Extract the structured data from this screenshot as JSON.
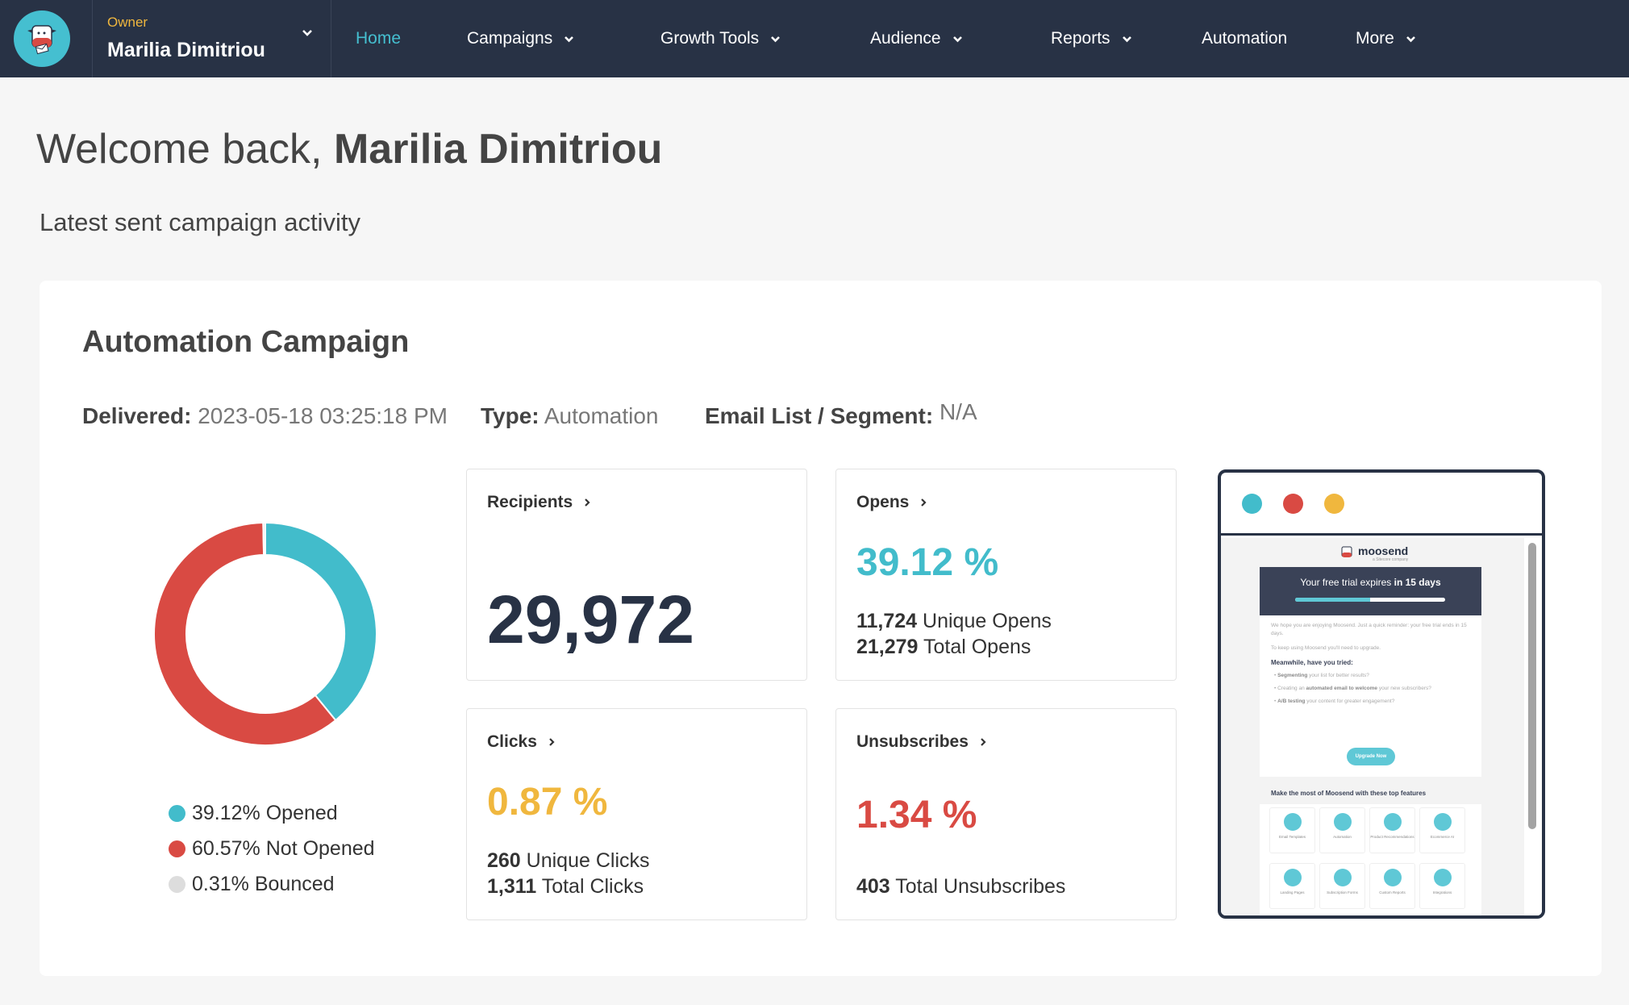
{
  "nav": {
    "logo_icon": "moosend-cow-logo",
    "owner_role": "Owner",
    "owner_name": "Marilia Dimitriou",
    "items": [
      {
        "label": "Home",
        "active": true,
        "dropdown": false
      },
      {
        "label": "Campaigns",
        "active": false,
        "dropdown": true
      },
      {
        "label": "Growth Tools",
        "active": false,
        "dropdown": true
      },
      {
        "label": "Audience",
        "active": false,
        "dropdown": true
      },
      {
        "label": "Reports",
        "active": false,
        "dropdown": true
      },
      {
        "label": "Automation",
        "active": false,
        "dropdown": false
      },
      {
        "label": "More",
        "active": false,
        "dropdown": true
      }
    ]
  },
  "header": {
    "welcome_prefix": "Welcome back, ",
    "welcome_name": "Marilia Dimitriou",
    "subtitle": "Latest sent campaign activity"
  },
  "campaign": {
    "title": "Automation Campaign",
    "delivered_label": "Delivered:",
    "delivered_value": "2023-05-18 03:25:18 PM",
    "type_label": "Type:",
    "type_value": "Automation",
    "list_label": "Email List / Segment:",
    "list_value": "N/A"
  },
  "chart_data": {
    "type": "pie",
    "donut": true,
    "title": "",
    "slices": [
      {
        "label": "Opened",
        "value": 39.12,
        "color": "#42bccb",
        "legend": "39.12% Opened"
      },
      {
        "label": "Not Opened",
        "value": 60.57,
        "color": "#d94a43",
        "legend": "60.57% Not Opened"
      },
      {
        "label": "Bounced",
        "value": 0.31,
        "color": "#dddddd",
        "legend": "0.31% Bounced"
      }
    ],
    "legend_position": "bottom"
  },
  "stats": {
    "recipients": {
      "label": "Recipients",
      "value": "29,972"
    },
    "opens": {
      "label": "Opens",
      "rate": "39.12 %",
      "unique_value": "11,724",
      "unique_label": "Unique Opens",
      "total_value": "21,279",
      "total_label": "Total Opens"
    },
    "clicks": {
      "label": "Clicks",
      "rate": "0.87 %",
      "unique_value": "260",
      "unique_label": "Unique Clicks",
      "total_value": "1,311",
      "total_label": "Total Clicks"
    },
    "unsubscribes": {
      "label": "Unsubscribes",
      "rate": "1.34 %",
      "total_value": "403",
      "total_label": "Total Unsubscribes"
    }
  },
  "colors": {
    "nav_bg": "#283245",
    "accent_teal": "#42bccb",
    "accent_red": "#d94a43",
    "accent_yellow": "#f0b73e",
    "dark_number": "#283245"
  },
  "preview": {
    "window_dots": [
      "#42bccb",
      "#d94a43",
      "#f0b73e"
    ],
    "brand": "moosend",
    "brand_sub": "a Sitecore company",
    "banner_prefix": "Your free trial expires ",
    "banner_bold": "in 15 days",
    "trial_progress": 0.5,
    "p1": "We hope you are enjoying Moosend. Just a quick reminder: your free trial ends in 15 days.",
    "p2": "To keep using Moosend you'll need to upgrade.",
    "meanwhile": "Meanwhile, have you tried:",
    "tips": [
      {
        "bold": "Segmenting",
        "rest": " your list for better results?"
      },
      {
        "pre": "Creating an ",
        "bold": "automated email to welcome",
        "rest": " your new subscribers?"
      },
      {
        "bold": "A/B testing",
        "rest": " your content for greater engagement?"
      }
    ],
    "upgrade_label": "Upgrade Now",
    "features_heading": "Make the most of Moosend with these top features",
    "features": [
      "Email Templates",
      "Automation",
      "Product Recommendations",
      "Ecommerce AI",
      "Landing Pages",
      "Subscription Forms",
      "Custom Reports",
      "Integrations"
    ]
  }
}
